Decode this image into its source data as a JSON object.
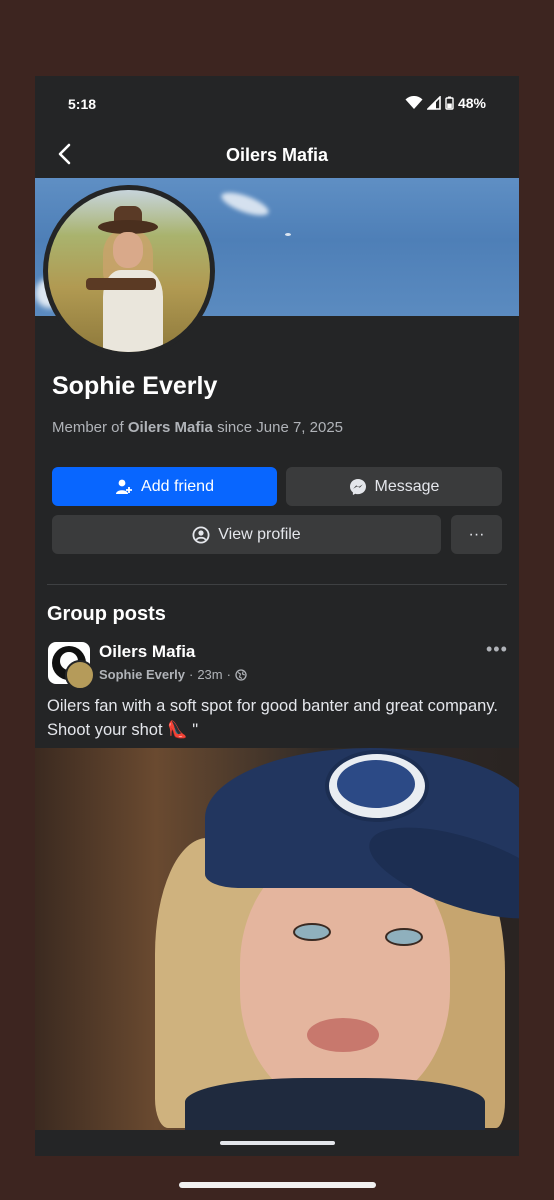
{
  "status_bar": {
    "time": "5:18",
    "battery": "48%"
  },
  "header": {
    "title": "Oilers Mafia"
  },
  "profile": {
    "name": "Sophie Everly",
    "member_prefix": "Member of ",
    "group": "Oilers Mafia",
    "member_suffix": " since June 7, 2025"
  },
  "actions": {
    "add_friend": "Add friend",
    "message": "Message",
    "view_profile": "View profile",
    "more": "···"
  },
  "section_title": "Group posts",
  "post": {
    "group": "Oilers Mafia",
    "author": "Sophie Everly",
    "time": "23m",
    "text": "Oilers fan with a soft spot for good banter and great company. Shoot your shot 👠 \"",
    "more": "•••"
  },
  "colors": {
    "accent": "#0866ff",
    "background": "#242526",
    "button": "#3a3b3c"
  }
}
